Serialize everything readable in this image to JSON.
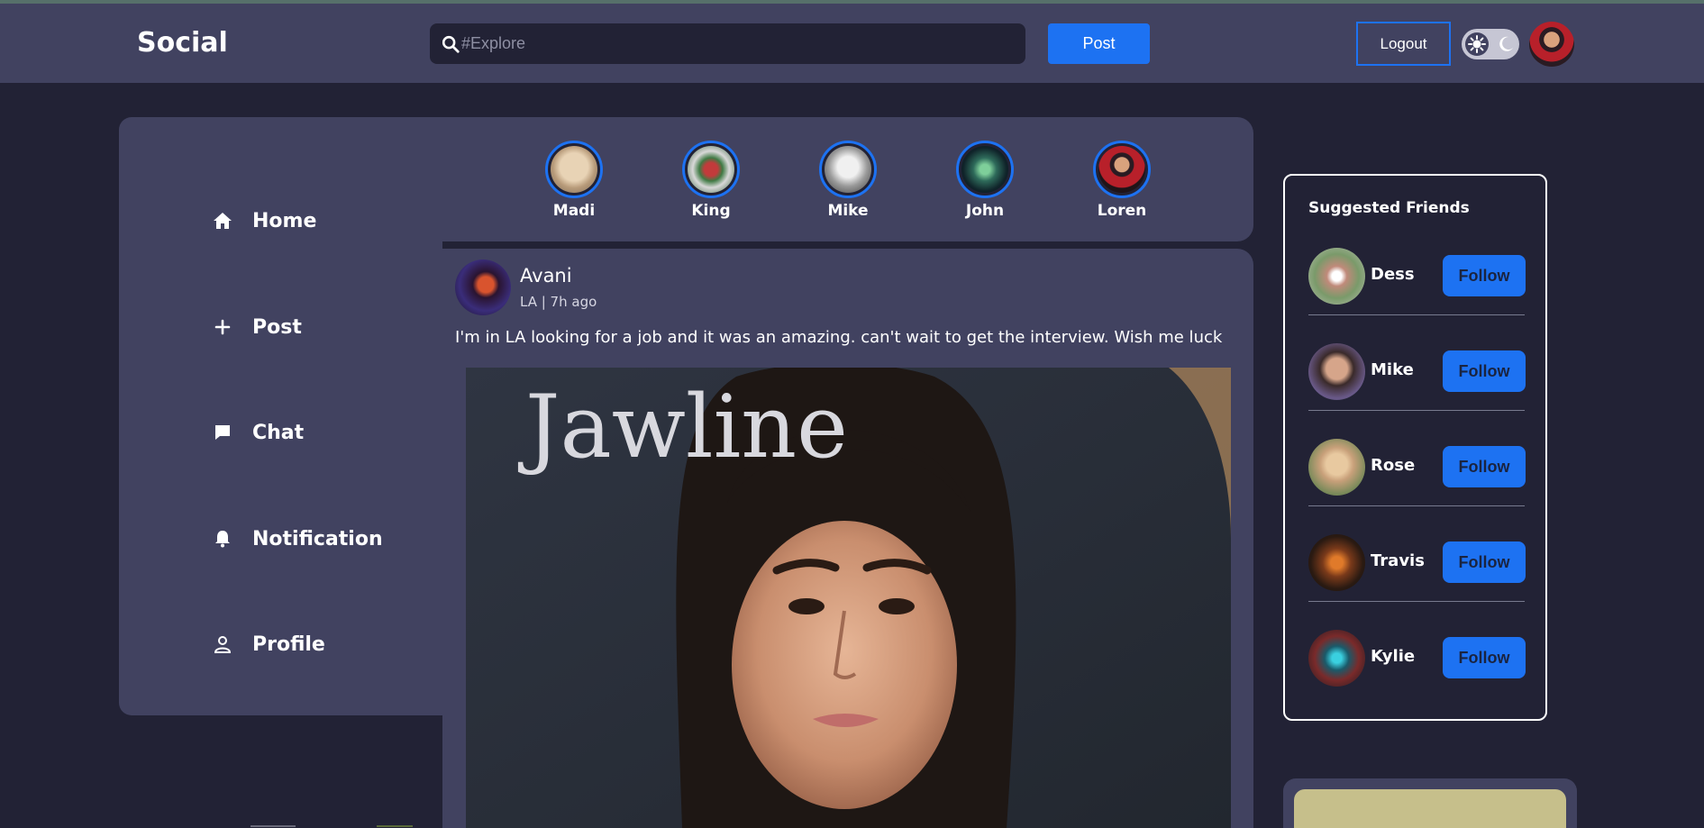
{
  "header": {
    "brand": "Social",
    "search_placeholder": "#Explore",
    "post_button": "Post",
    "logout_button": "Logout"
  },
  "nav": {
    "items": [
      {
        "label": "Home",
        "icon": "home-icon"
      },
      {
        "label": "Post",
        "icon": "plus-icon"
      },
      {
        "label": "Chat",
        "icon": "chat-icon"
      },
      {
        "label": "Notification",
        "icon": "bell-icon"
      },
      {
        "label": "Profile",
        "icon": "user-icon"
      }
    ]
  },
  "stories": [
    {
      "name": "Madi"
    },
    {
      "name": "King"
    },
    {
      "name": "Mike"
    },
    {
      "name": "John"
    },
    {
      "name": "Loren"
    }
  ],
  "post": {
    "author": "Avani",
    "meta": "LA | 7h ago",
    "text": "I'm in LA looking for a job and it was an amazing. can't wait to get the interview. Wish me luck",
    "image_text": "Jawline"
  },
  "suggested": {
    "title": "Suggested Friends",
    "friends": [
      {
        "name": "Dess",
        "button": "Follow"
      },
      {
        "name": "Mike",
        "button": "Follow"
      },
      {
        "name": "Rose",
        "button": "Follow"
      },
      {
        "name": "Travis",
        "button": "Follow"
      },
      {
        "name": "Kylie",
        "button": "Follow"
      }
    ]
  },
  "colors": {
    "accent": "#1d72f2",
    "background": "#222235",
    "panel": "#414260"
  }
}
